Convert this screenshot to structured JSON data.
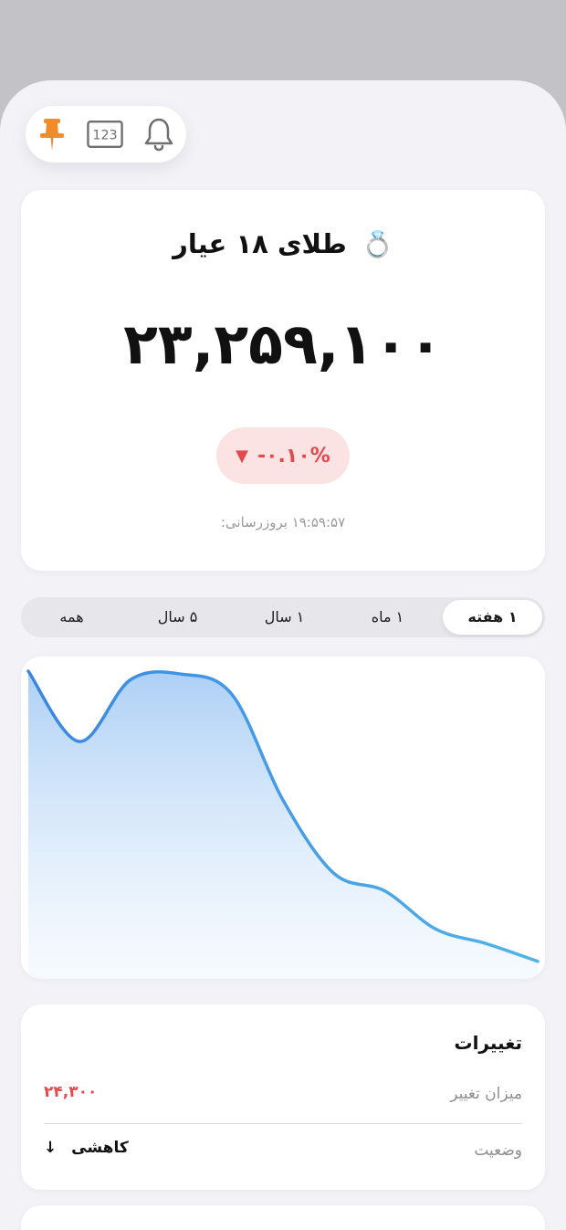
{
  "colors": {
    "accent": "#4a90e2",
    "negative": "#e5484d",
    "pin": "#f28c28"
  },
  "toolbar": {
    "pin_icon": "pin-icon",
    "numbers_label": "123",
    "bell_icon": "bell-icon"
  },
  "asset": {
    "emoji": "💍",
    "title": "طلای ۱۸ عیار",
    "price": "۲۳,۲۵۹,۱۰۰",
    "change": "-۰.۱۰%",
    "change_arrow": "▼",
    "updated": "۱۹:۵۹:۵۷ بروزرسانی:"
  },
  "tabs": [
    {
      "label": "۱ هفته",
      "active": true
    },
    {
      "label": "۱ ماه",
      "active": false
    },
    {
      "label": "۱ سال",
      "active": false
    },
    {
      "label": "۵ سال",
      "active": false
    },
    {
      "label": "همه",
      "active": false
    }
  ],
  "chart_data": {
    "type": "area",
    "x": [
      1,
      2,
      3,
      4,
      5,
      6,
      7,
      8,
      9,
      10,
      11
    ],
    "values": [
      100,
      76,
      97,
      99,
      92,
      56,
      31,
      25,
      12,
      7,
      1
    ],
    "ylim": [
      0,
      100
    ],
    "grid": false,
    "line_color": "#4a90e2"
  },
  "changes": {
    "title": "تغییرات",
    "amount_label": "میزان تغییر",
    "amount_value": "۲۴,۳۰۰",
    "status_label": "وضعیت",
    "status_value": "کاهشی",
    "status_arrow": "↓"
  }
}
